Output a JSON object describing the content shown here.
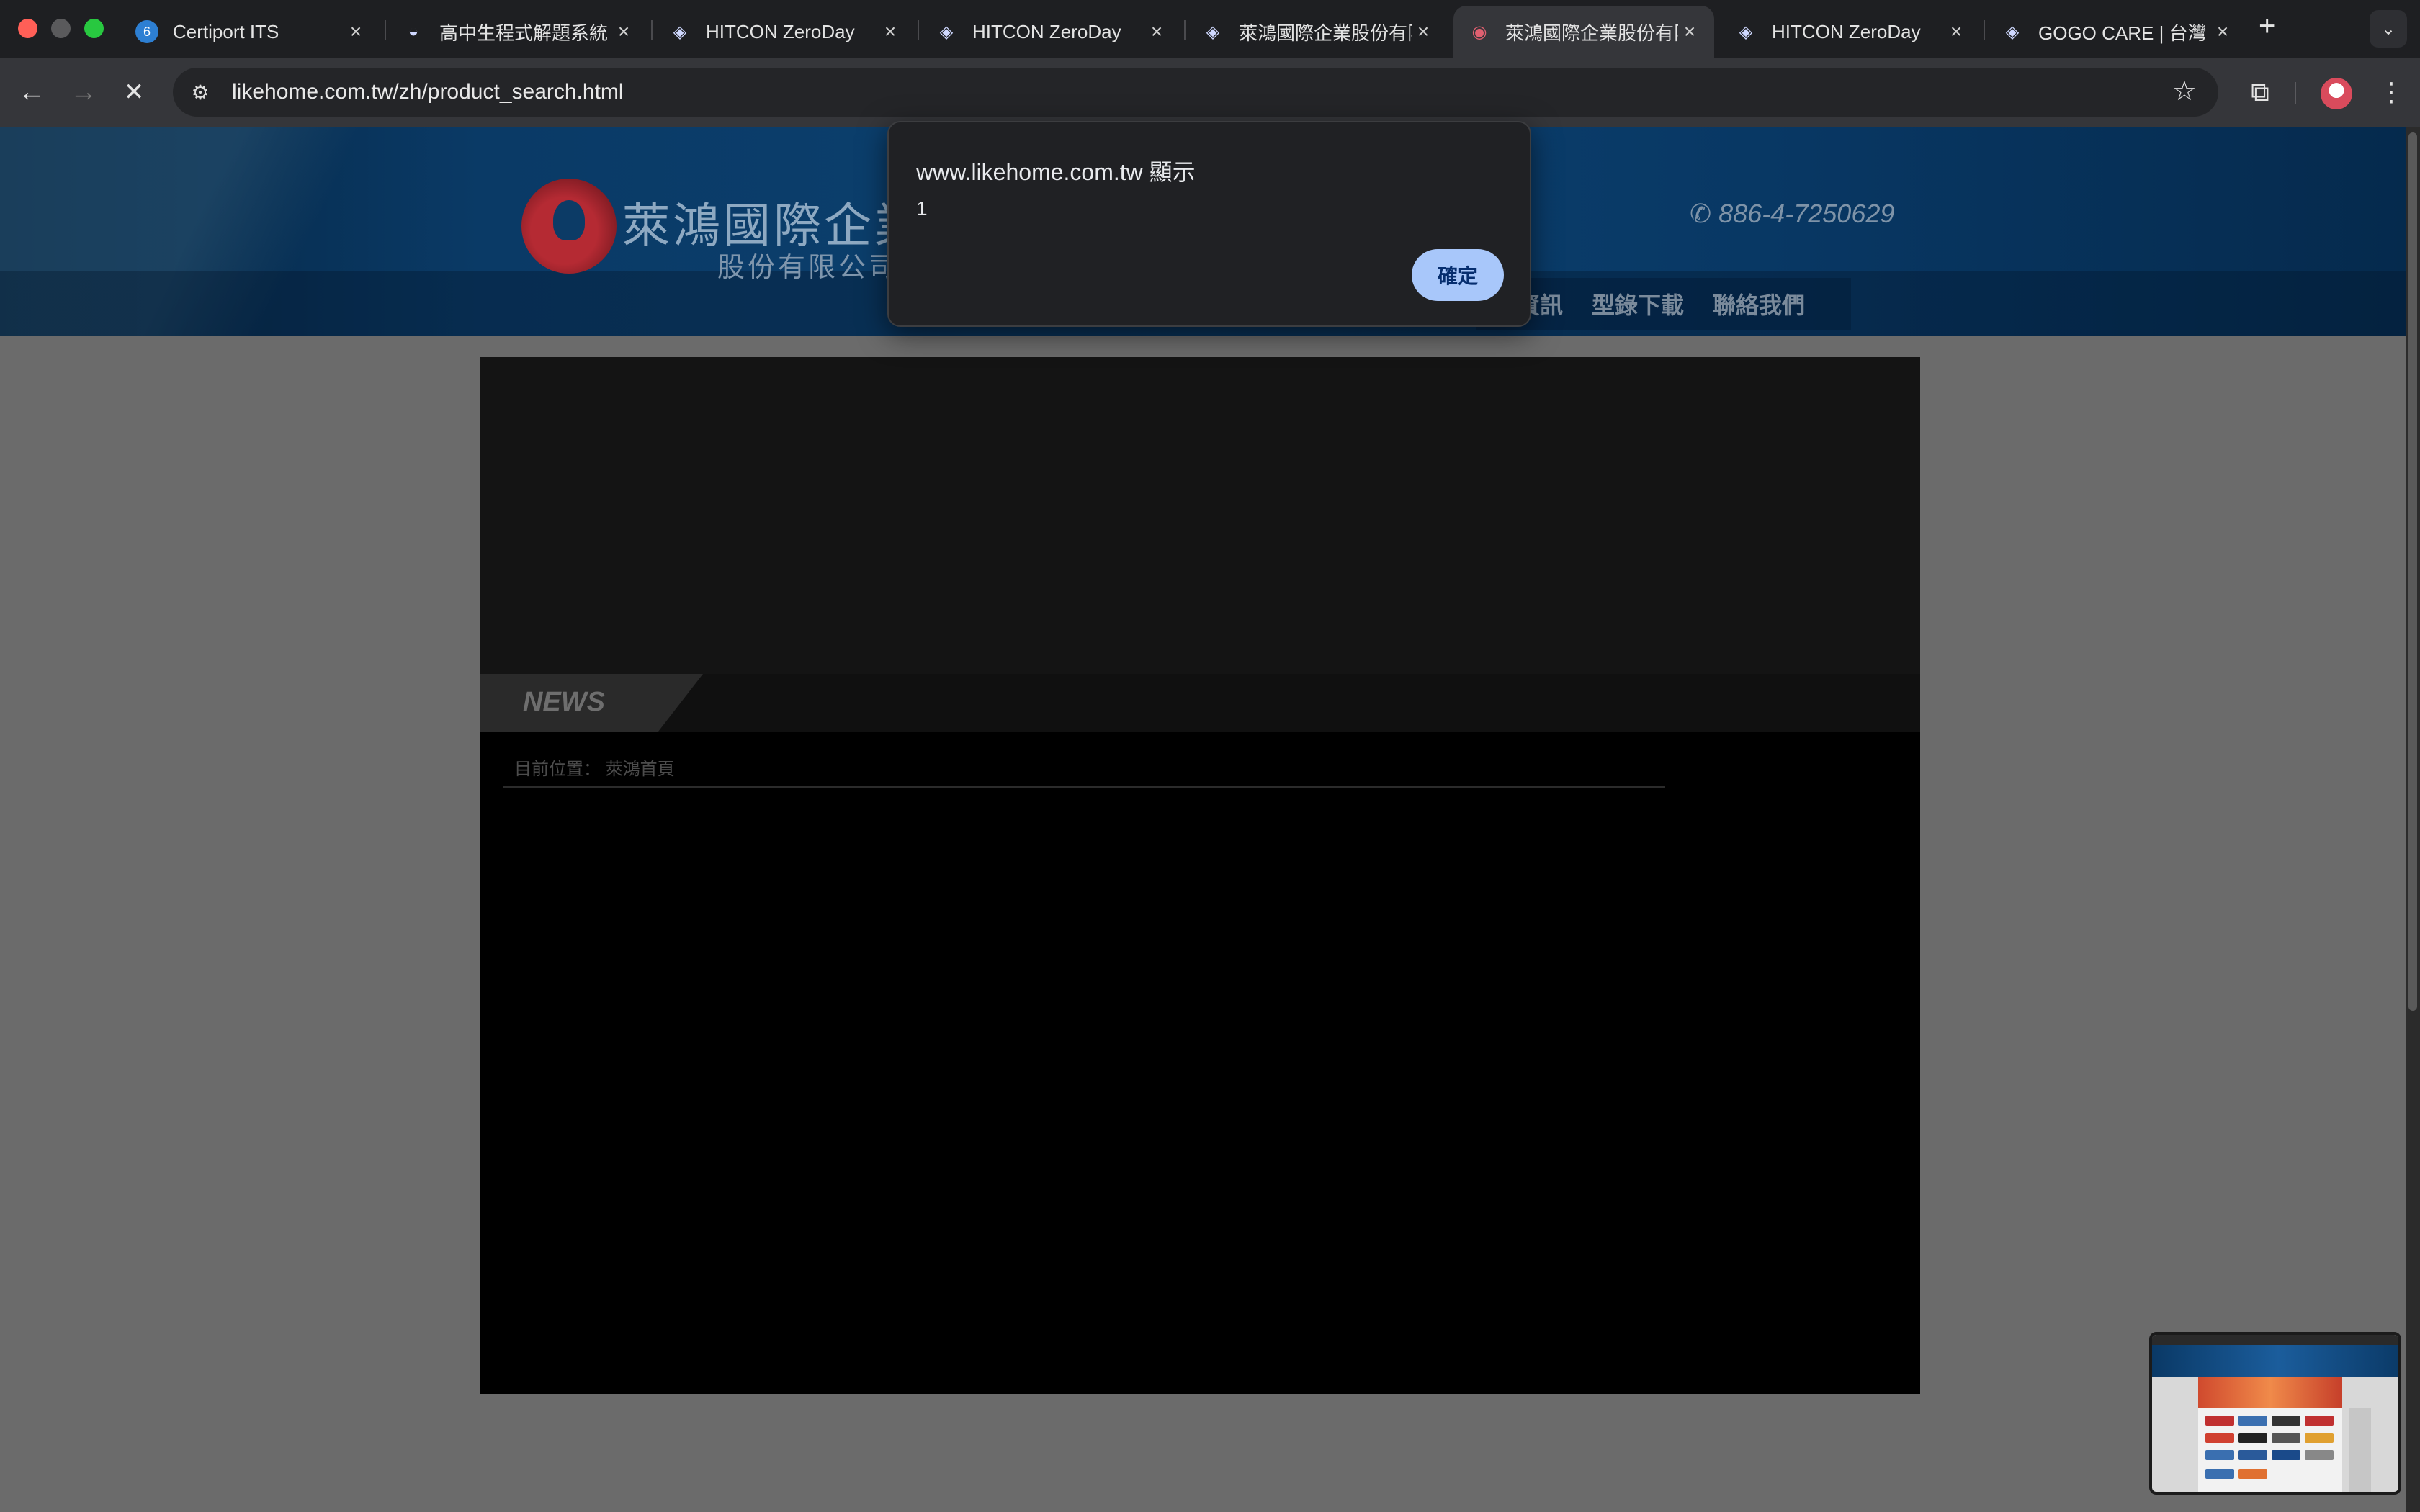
{
  "browser": {
    "tabs": [
      {
        "title": "Certiport ITS",
        "icon": "certiport-icon",
        "active": false
      },
      {
        "title": "高中生程式解題系統",
        "icon": "zerojudge-icon",
        "active": false
      },
      {
        "title": "HITCON ZeroDay",
        "icon": "hitcon-icon",
        "active": false
      },
      {
        "title": "HITCON ZeroDay",
        "icon": "hitcon-icon",
        "active": false
      },
      {
        "title": "萊鴻國際企業股份有限",
        "icon": "hitcon-icon",
        "active": false
      },
      {
        "title": "萊鴻國際企業股份有限",
        "icon": "likehome-icon",
        "active": true
      },
      {
        "title": "HITCON ZeroDay",
        "icon": "hitcon-icon",
        "active": false
      },
      {
        "title": "GOGO CARE | 台灣",
        "icon": "hitcon-icon",
        "active": false
      }
    ],
    "url": "likehome.com.tw/zh/product_search.html",
    "colors": {
      "tabbar": "#1e1f22",
      "toolbar": "#35363a",
      "omnibox": "#242528"
    }
  },
  "site": {
    "company_name": "萊鴻國際企業",
    "company_suffix": "股份有限公司",
    "phone": "886-4-7250629",
    "nav": [
      "購資訊",
      "型錄下載",
      "聯絡我們"
    ],
    "news_label": "NEWS",
    "breadcrumb_label": "目前位置：",
    "breadcrumb_home": "萊鴻首頁",
    "colors": {
      "header": "#0c4170",
      "logo_red": "#b52a33"
    }
  },
  "alert": {
    "title": "www.likehome.com.tw 顯示",
    "message": "1",
    "ok_label": "確定",
    "ok_color": "#a8c7fa"
  }
}
